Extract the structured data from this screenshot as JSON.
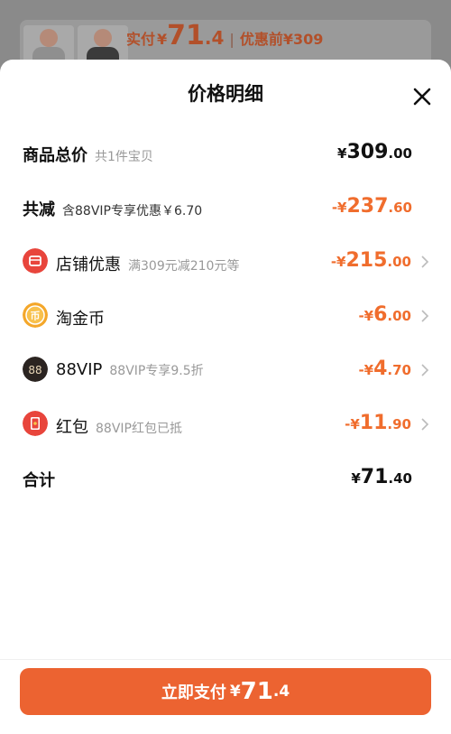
{
  "background": {
    "pay_label": "实付",
    "pay_currency": "¥",
    "pay_int": "71",
    "pay_dec": ".4",
    "separator": "|",
    "before_label": "优惠前¥309"
  },
  "sheet": {
    "title": "价格明细",
    "close_icon": "close-icon"
  },
  "rows": {
    "total": {
      "label": "商品总价",
      "sub": "共1件宝贝",
      "currency": "¥",
      "int": "309",
      "dec": ".00"
    },
    "reduce": {
      "label": "共减",
      "sub": "含88VIP专享优惠￥6.70",
      "currency": "-¥",
      "int": "237",
      "dec": ".60"
    },
    "shop": {
      "label": "店铺优惠",
      "sub": "满309元减210元等",
      "currency": "-¥",
      "int": "215",
      "dec": ".00",
      "icon": "shop-coupon-icon",
      "icon_color": "#e8453c"
    },
    "coin": {
      "label": "淘金币",
      "sub": "",
      "currency": "-¥",
      "int": "6",
      "dec": ".00",
      "icon": "gold-coin-icon",
      "icon_color": "#f4a72a"
    },
    "vip": {
      "label": "88VIP",
      "sub": "88VIP专享9.5折",
      "currency": "-¥",
      "int": "4",
      "dec": ".70",
      "icon": "vip-88-icon",
      "icon_color": "#2b2421"
    },
    "redpack": {
      "label": "红包",
      "sub": "88VIP红包已抵",
      "currency": "-¥",
      "int": "11",
      "dec": ".90",
      "icon": "red-packet-icon",
      "icon_color": "#e8453c"
    },
    "sum": {
      "label": "合计",
      "currency": "¥",
      "int": "71",
      "dec": ".40"
    }
  },
  "footer": {
    "button_label": "立即支付",
    "currency": "¥",
    "int": "71",
    "dec": ".4"
  },
  "colors": {
    "accent": "#f06d2d",
    "button": "#ec6331"
  }
}
